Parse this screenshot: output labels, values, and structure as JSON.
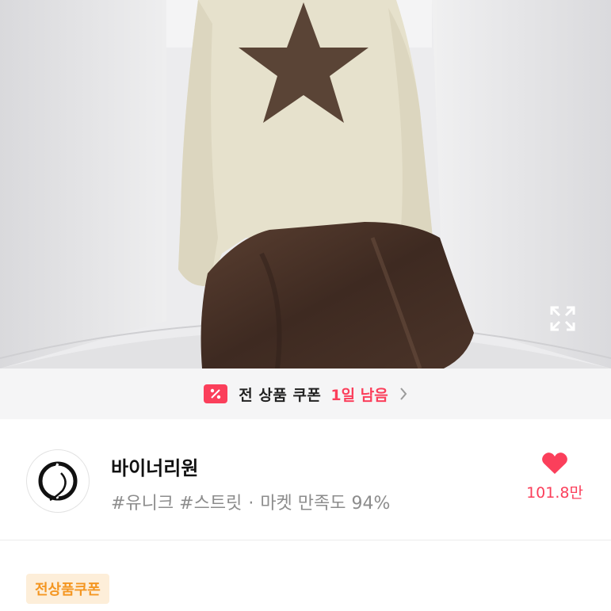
{
  "coupon_banner": {
    "text": "전 상품 쿠폰",
    "days_left": "1일 남음",
    "icon": "percent-coupon-icon",
    "chevron_icon": "chevron-right-icon"
  },
  "store": {
    "name": "바이너리원",
    "tag1": "#유니크",
    "tag2": "#스트릿",
    "separator": "·",
    "satisfaction": "마켓 만족도 94%",
    "likes": "101.8만",
    "like_icon": "heart-icon",
    "logo_icon": "store-logo-icon"
  },
  "coupon_tag": {
    "label": "전상품쿠폰"
  },
  "hero": {
    "expand_icon": "expand-icon"
  },
  "colors": {
    "accent": "#fb3f5b",
    "coupon_tag_bg": "#fdeed9",
    "coupon_tag_text": "#f49621",
    "banner_bg": "#f5f5f6"
  }
}
